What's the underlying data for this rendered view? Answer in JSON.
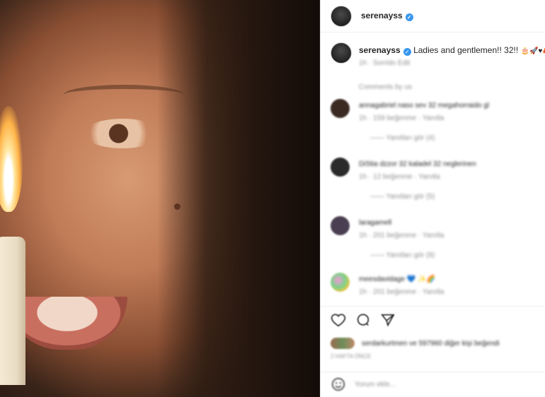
{
  "post": {
    "username": "serenayss",
    "caption": "Ladies and gentlemen!! 32!!",
    "caption_emojis": "🎂🚀♥🦀",
    "caption_meta": "1h · Sorrido Edit",
    "comments_header": "Comments by us",
    "comments": [
      {
        "text": "annagabriel naso sev 32 megahorraido gl",
        "meta": "1h · 159 beğenme · Yanıtla",
        "replies": "—— Yanıtları gör (4)"
      },
      {
        "text": "DiStia dzzor 32 kaladel 32 neglerinen",
        "meta": "1h · 12 beğenme · Yanıtla",
        "replies": "—— Yanıtları gör (5)"
      },
      {
        "text": "laragamell",
        "meta": "1h · 201 beğenme · Yanıtla",
        "replies": "—— Yanıtları gör (9)"
      },
      {
        "text": "meesdavidage 💙 ✨🌈",
        "meta": "1h · 201 beğenme · Yanıtla",
        "replies": ""
      }
    ],
    "likes_text": "serdarkurtmen ve 597960 diğer kişi beğendi",
    "time_ago": "2 HAFTA ÖNCE",
    "add_comment_placeholder": "Yorum ekle..."
  },
  "colors": {
    "verified": "#3897f0",
    "text": "#262626",
    "muted": "#8e8e8e"
  }
}
